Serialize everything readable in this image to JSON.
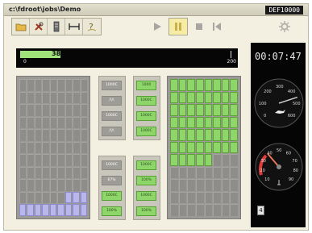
{
  "window": {
    "path": "c:\\fdroot\\jobs\\Demo",
    "job_id": "DEF10000"
  },
  "toolbar": {
    "file_buttons": [
      {
        "name": "folder-icon",
        "label": "open"
      },
      {
        "name": "tools-icon",
        "label": "tools"
      },
      {
        "name": "device-icon",
        "label": "device"
      },
      {
        "name": "width-icon",
        "label": "width"
      },
      {
        "name": "help-icon",
        "label": "help"
      }
    ],
    "transport": [
      {
        "name": "play-icon",
        "active": false
      },
      {
        "name": "pause-icon",
        "active": true
      },
      {
        "name": "stop-icon",
        "active": false
      },
      {
        "name": "rewind-icon",
        "active": false
      }
    ],
    "settings_icon": "gear-icon"
  },
  "progress": {
    "value": "38",
    "min": "0",
    "max": "200"
  },
  "panels": {
    "left_grid": {
      "lavender_cells": [
        [
          9,
          6
        ],
        [
          9,
          7
        ],
        [
          9,
          8
        ],
        [
          10,
          0
        ],
        [
          10,
          1
        ],
        [
          10,
          2
        ],
        [
          10,
          3
        ],
        [
          10,
          4
        ],
        [
          10,
          5
        ],
        [
          10,
          6
        ],
        [
          10,
          7
        ],
        [
          10,
          8
        ]
      ]
    },
    "mid_column_a": {
      "top": [
        "1000C",
        "/\\/\\",
        "1000C",
        "/\\/\\"
      ],
      "bottom": [
        "1000C",
        "67%",
        "1000C",
        "100%"
      ]
    },
    "mid_column_b": {
      "top": [
        "1000",
        "1000C",
        "1000C",
        "1000C"
      ],
      "bottom": [
        "1000C",
        "100%",
        "1000C",
        "100%"
      ]
    },
    "right_grid": {
      "green_rows": 6,
      "green_last_row_cols": 5
    }
  },
  "clock": {
    "time": "00:07:47"
  },
  "speed_gauge": {
    "labels": [
      "300",
      "200",
      "400",
      "100",
      "500",
      "0",
      "600"
    ],
    "needle_value": 460
  },
  "temp_gauge": {
    "labels": [
      "40",
      "50",
      "60",
      "30",
      "70",
      "20",
      "80",
      "10",
      "90"
    ],
    "needle_value": 38
  },
  "side_indicator": {
    "value": "4"
  }
}
